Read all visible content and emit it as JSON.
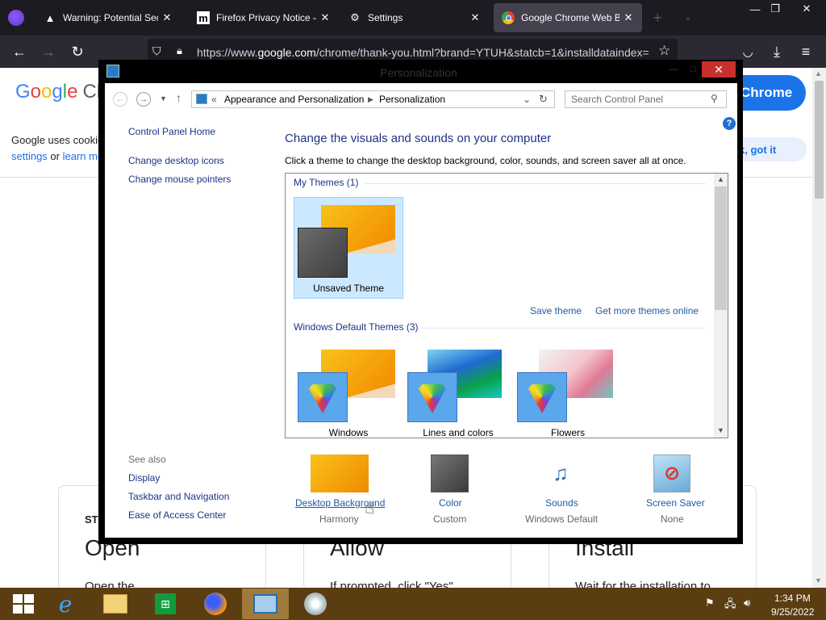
{
  "browser": {
    "tabs": [
      {
        "title": "Warning: Potential Security Risk Ahead",
        "icon": "warning-icon",
        "active": false
      },
      {
        "title": "Firefox Privacy Notice — Mozilla",
        "icon": "mozilla-icon",
        "active": false
      },
      {
        "title": "Settings",
        "icon": "gear-icon",
        "active": false
      },
      {
        "title": "Google Chrome Web Browser",
        "icon": "chrome-icon",
        "active": true
      }
    ],
    "url_prefix": "https://www.",
    "url_host": "google.com",
    "url_rest": "/chrome/thank-you.html?brand=YTUH&statcb=1&installdataindex="
  },
  "webpage": {
    "logo_letters": [
      "G",
      "o",
      "o",
      "g",
      "l",
      "e"
    ],
    "logo_suffix": "Ch",
    "chrome_button": "Chrome",
    "cookie_text": "Google uses cookie",
    "cookie_settings": "settings",
    "cookie_or": " or ",
    "cookie_learn": "learn mo",
    "ok_button": "k, got it",
    "step_heading": "ST",
    "steps": [
      {
        "title": "Open",
        "desc": "Open the"
      },
      {
        "title": "Allow",
        "desc": "If prompted, click \"Yes\""
      },
      {
        "title": "Install",
        "desc": "Wait for the installation to"
      }
    ]
  },
  "window": {
    "title": "Personalization",
    "breadcrumb_sep": "«",
    "breadcrumb": [
      "Appearance and Personalization",
      "Personalization"
    ],
    "search_placeholder": "Search Control Panel",
    "sidebar": {
      "home": "Control Panel Home",
      "links": [
        "Change desktop icons",
        "Change mouse pointers"
      ],
      "see_also_label": "See also",
      "see_also": [
        "Display",
        "Taskbar and Navigation",
        "Ease of Access Center"
      ]
    },
    "heading": "Change the visuals and sounds on your computer",
    "subtext": "Click a theme to change the desktop background, color, sounds, and screen saver all at once.",
    "my_themes_label": "My Themes (1)",
    "my_themes": [
      {
        "name": "Unsaved Theme",
        "selected": true
      }
    ],
    "save_theme": "Save theme",
    "get_more": "Get more themes online",
    "default_themes_label": "Windows Default Themes (3)",
    "default_themes": [
      {
        "name": "Windows"
      },
      {
        "name": "Lines and colors"
      },
      {
        "name": "Flowers"
      }
    ],
    "bottom": [
      {
        "label": "Desktop Background",
        "sub": "Harmony",
        "icon": "desktop-background-icon"
      },
      {
        "label": "Color",
        "sub": "Custom",
        "icon": "color-icon"
      },
      {
        "label": "Sounds",
        "sub": "Windows Default",
        "icon": "sounds-icon"
      },
      {
        "label": "Screen Saver",
        "sub": "None",
        "icon": "screen-saver-icon"
      }
    ]
  },
  "taskbar": {
    "apps": [
      "start",
      "internet-explorer",
      "file-explorer",
      "store",
      "firefox",
      "control-panel",
      "media-center"
    ],
    "active_app": "control-panel",
    "time": "1:34 PM",
    "date": "9/25/2022"
  },
  "colors": {
    "taskbar": "#5a3d10",
    "link": "#1e3287",
    "close": "#c7302d",
    "selection": "#cce8ff"
  }
}
